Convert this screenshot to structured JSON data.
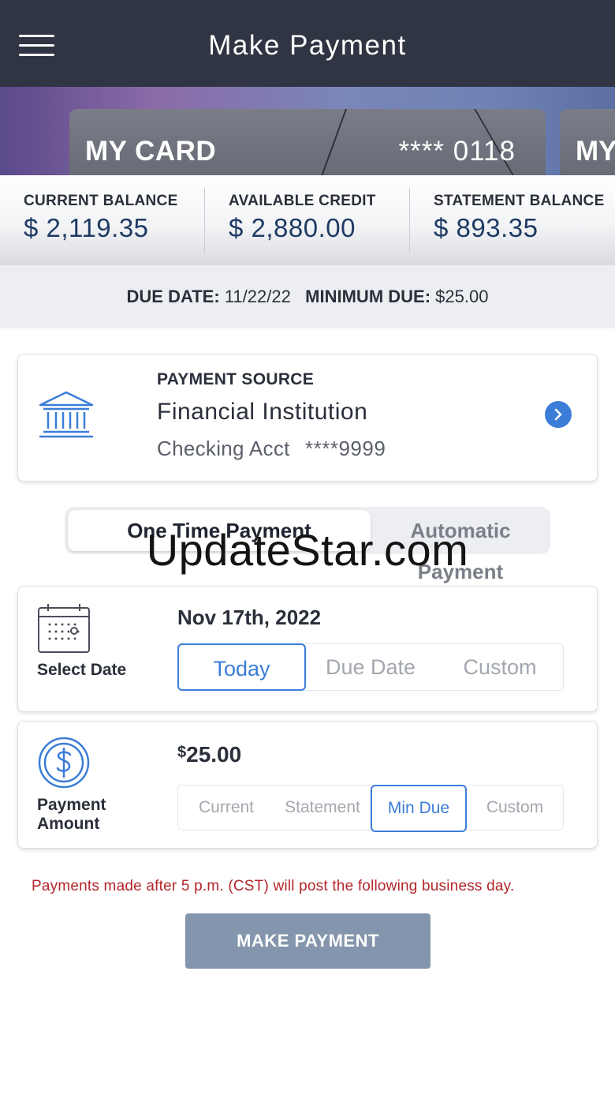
{
  "header": {
    "title": "Make Payment",
    "menu_icon": "hamburger-menu-icon"
  },
  "cards": [
    {
      "name": "MY CARD",
      "number": "**** 0118"
    },
    {
      "name": "MY"
    }
  ],
  "balances": {
    "current": {
      "label": "CURRENT BALANCE",
      "value": "$ 2,119.35"
    },
    "available": {
      "label": "AVAILABLE CREDIT",
      "value": "$ 2,880.00"
    },
    "statement": {
      "label": "STATEMENT BALANCE",
      "value": "$ 893.35"
    }
  },
  "due": {
    "date_label": "DUE DATE:",
    "date_value": "11/22/22",
    "min_label": "MINIMUM DUE:",
    "min_value": "$25.00"
  },
  "payment_source": {
    "label": "PAYMENT SOURCE",
    "name": "Financial Institution",
    "account_type": "Checking Acct",
    "account_number": "****9999",
    "icon": "bank-icon",
    "action_icon": "chevron-right-icon"
  },
  "payment_type": {
    "options": [
      "One Time Payment",
      "Automatic Payment"
    ],
    "selected": "One Time Payment"
  },
  "watermark": "UpdateStar.com",
  "date_section": {
    "label": "Select Date",
    "value": "Nov 17th, 2022",
    "options": [
      "Today",
      "Due Date",
      "Custom"
    ],
    "selected": "Today",
    "icon": "calendar-icon"
  },
  "amount_section": {
    "label_line1": "Payment",
    "label_line2": "Amount",
    "currency": "$",
    "value": "25.00",
    "options": [
      "Current",
      "Statement",
      "Min Due",
      "Custom"
    ],
    "selected": "Min Due",
    "icon": "dollar-circle-icon"
  },
  "notice": "Payments made after 5 p.m. (CST) will post the following business day.",
  "submit_label": "MAKE PAYMENT",
  "colors": {
    "header_bg": "#2f3542",
    "accent": "#3b7dd8",
    "balance_value": "#1e3a64",
    "notice_text": "#b3262b",
    "submit_bg": "#8496ad"
  }
}
